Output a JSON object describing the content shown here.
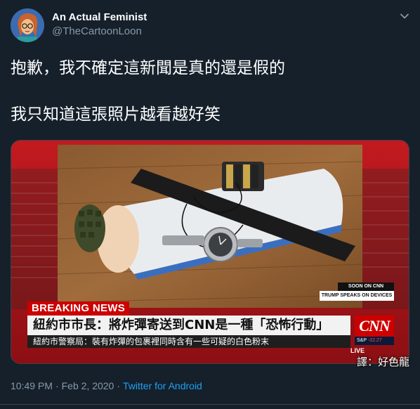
{
  "author": {
    "display_name": "An Actual Feminist",
    "handle": "@TheCartoonLoon",
    "avatar_icon": "cartoon-avatar-icon"
  },
  "tweet": {
    "line1": "抱歉，我不確定這新聞是真的還是假的",
    "line2": "我只知道這張照片越看越好笑"
  },
  "media": {
    "breaking_label": "BREAKING NEWS",
    "headline": "紐約市市長：將炸彈寄送到CNN是一種「恐怖行動」",
    "subheadline": "紐約市警察局：裝有炸彈的包裹裡同時含有一些可疑的白色粉末",
    "network_logo": "CNN",
    "soon_label": "SOON ON CNN",
    "soon_sub": "TRUMP SPEAKS ON DEVICES",
    "ticker_symbol": "S&P",
    "ticker_value": "-32.27",
    "channel_bug": "LIVE",
    "translator_credit": "譯：好色龍",
    "accent_red": "#cc0000"
  },
  "meta": {
    "time": "10:49 PM",
    "separator": "·",
    "date": "Feb 2, 2020",
    "source": "Twitter for Android"
  },
  "menu_icon": "chevron-down-icon"
}
